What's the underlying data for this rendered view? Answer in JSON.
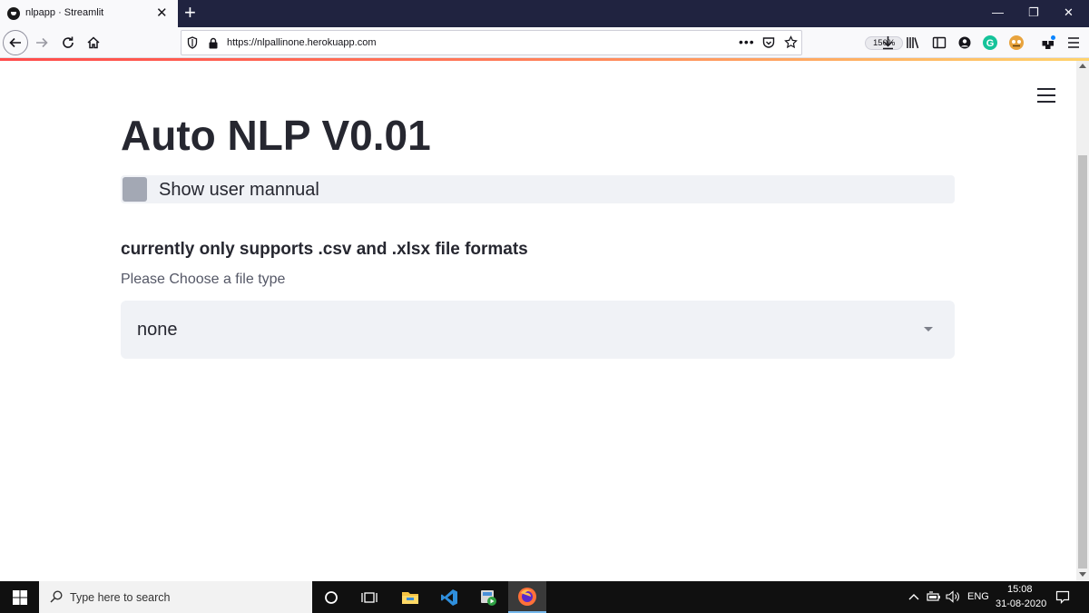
{
  "browser": {
    "tab_title": "nlpapp · Streamlit",
    "url": "https://nlpallinone.herokuapp.com",
    "zoom": "150%"
  },
  "page": {
    "title": "Auto NLP V0.01",
    "checkbox_label": "Show user mannual",
    "checkbox_checked": false,
    "section_heading": "currently only supports .csv and .xlsx file formats",
    "select_label": "Please Choose a file type",
    "select_value": "none"
  },
  "taskbar": {
    "search_placeholder": "Type here to search",
    "language": "ENG",
    "time": "15:08",
    "date": "31-08-2020"
  },
  "colors": {
    "accent_gradient_start": "#ff4b4b",
    "accent_gradient_end": "#ffd36b",
    "widget_background": "#f0f2f6",
    "text_primary": "#262730"
  }
}
